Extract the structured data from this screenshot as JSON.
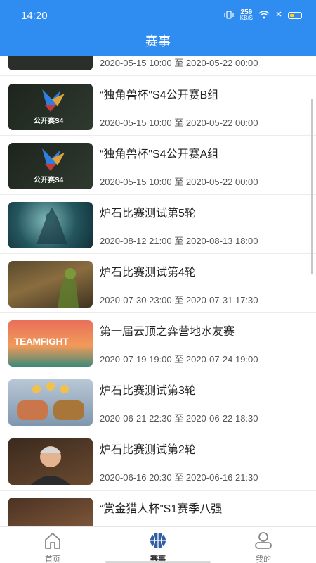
{
  "status": {
    "time": "14:20",
    "speed_value": "259",
    "speed_unit": "KB/S"
  },
  "header": {
    "title": "赛事"
  },
  "events": [
    {
      "title": "",
      "date": "2020-05-15 10:00 至 2020-05-22 00:00",
      "thumb": "partial-dark"
    },
    {
      "title": "“独角兽杯\"S4公开赛B组",
      "date": "2020-05-15 10:00 至 2020-05-22 00:00",
      "thumb": "unicorn",
      "logo_text": "公开赛S4"
    },
    {
      "title": "“独角兽杯\"S4公开赛A组",
      "date": "2020-05-15 10:00 至 2020-05-22 00:00",
      "thumb": "unicorn",
      "logo_text": "公开赛S4"
    },
    {
      "title": "炉石比赛测试第5轮",
      "date": "2020-08-12 21:00 至 2020-08-13 18:00",
      "thumb": "teal-monster"
    },
    {
      "title": "炉石比赛测试第4轮",
      "date": "2020-07-30 23:00 至 2020-07-31 17:30",
      "thumb": "brown-tree"
    },
    {
      "title": "第一届云顶之弈营地水友赛",
      "date": "2020-07-19 19:00 至 2020-07-24 19:00",
      "thumb": "teamfight",
      "logo_text": "TEAMFIGHT"
    },
    {
      "title": "炉石比赛测试第3轮",
      "date": "2020-06-21 22:30 至 2020-06-22 18:30",
      "thumb": "fists"
    },
    {
      "title": "炉石比赛测试第2轮",
      "date": "2020-06-16 20:30 至 2020-06-16 21:30",
      "thumb": "portrait"
    },
    {
      "title": "“赏金猎人杯”S1赛季八强",
      "date": "",
      "thumb": "partial-warm"
    }
  ],
  "tabs": [
    {
      "label": "首页",
      "icon": "home-icon"
    },
    {
      "label": "赛事",
      "icon": "basketball-icon"
    },
    {
      "label": "我的",
      "icon": "person-icon"
    }
  ],
  "colors": {
    "primary": "#2f8cf0",
    "battery": "#ffd21f"
  }
}
